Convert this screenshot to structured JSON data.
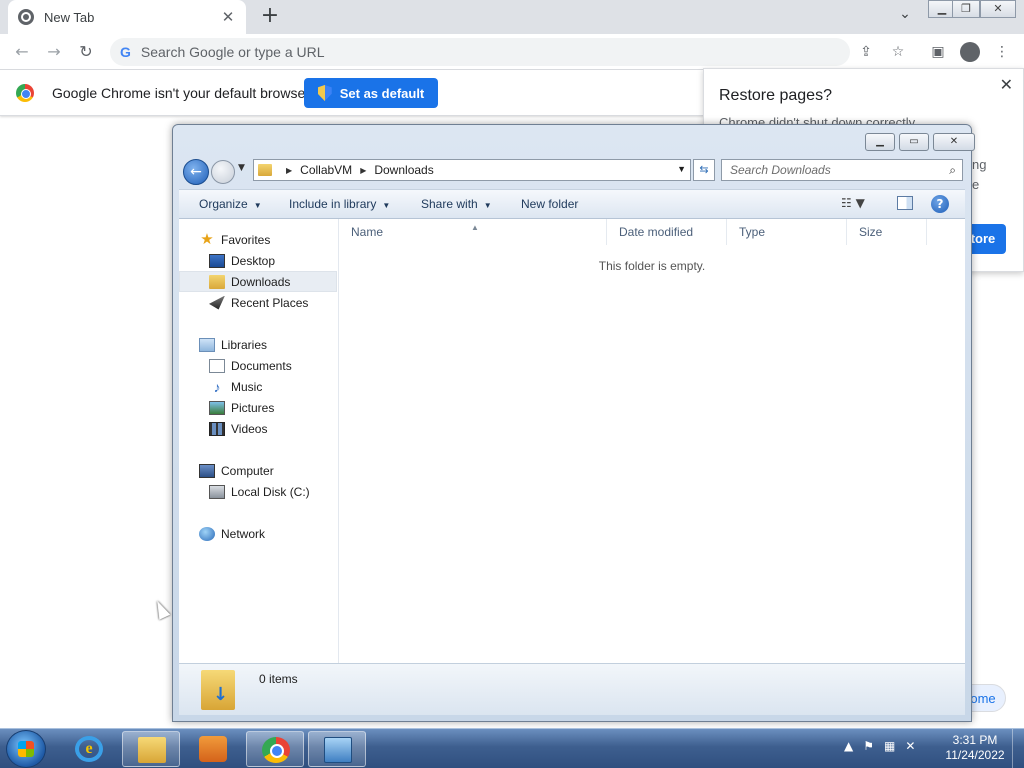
{
  "chrome": {
    "tab": {
      "title": "New Tab"
    },
    "omnibox": {
      "placeholder": "Search Google or type a URL"
    },
    "infobar": {
      "message": "Google Chrome isn't your default browser",
      "button_label": "Set as default"
    },
    "restore_panel": {
      "title": "Restore pages?",
      "subtitle": "Chrome didn't shut down correctly.",
      "behind_text_1": "ng",
      "behind_text_2": "e",
      "restore_label": "tore",
      "customize_label": "ome"
    }
  },
  "explorer": {
    "breadcrumb": [
      "CollabVM",
      "Downloads"
    ],
    "search_placeholder": "Search Downloads",
    "commands": {
      "organize": "Organize",
      "include": "Include in library",
      "share": "Share with",
      "new_folder": "New folder"
    },
    "nav": {
      "favorites": "Favorites",
      "desktop": "Desktop",
      "downloads": "Downloads",
      "recent": "Recent Places",
      "libraries": "Libraries",
      "documents": "Documents",
      "music": "Music",
      "pictures": "Pictures",
      "videos": "Videos",
      "computer": "Computer",
      "local_disk": "Local Disk (C:)",
      "network": "Network"
    },
    "columns": {
      "name": "Name",
      "date": "Date modified",
      "type": "Type",
      "size": "Size"
    },
    "empty_message": "This folder is empty.",
    "item_count": "0 items"
  },
  "taskbar": {
    "clock_time": "3:31 PM",
    "clock_date": "11/24/2022"
  }
}
